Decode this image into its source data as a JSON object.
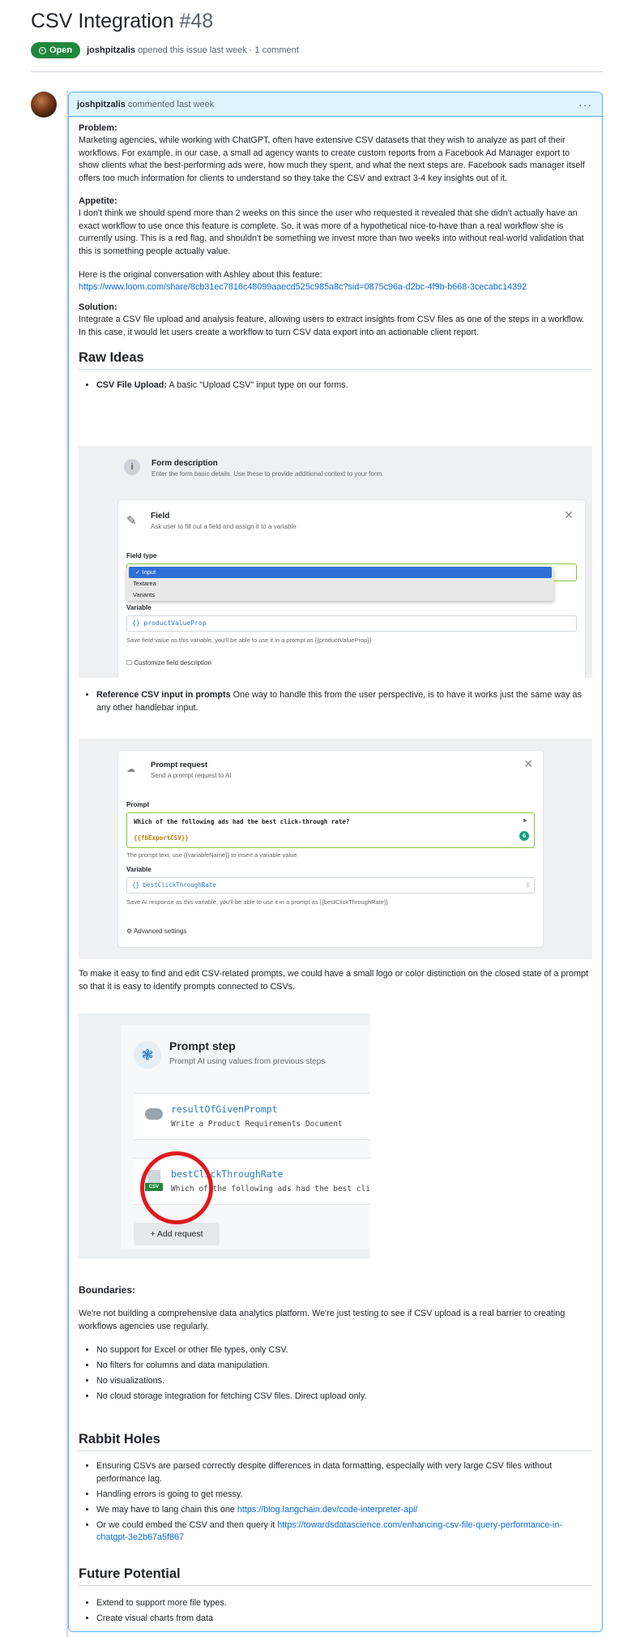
{
  "issue": {
    "title": "CSV Integration",
    "number": "#48",
    "state": "Open",
    "author": "joshpitzalis",
    "meta": "opened this issue last week · 1 comment"
  },
  "comment": {
    "author": "joshpitzalis",
    "time": "commented last week",
    "menu": "···"
  },
  "body": {
    "problem_label": "Problem:",
    "problem_text": "Marketing agencies, while working with ChatGPT, often have extensive CSV datasets that they wish to analyze as part of their workflows. For example, in our case, a small ad agency wants to create custom reports from a Facebook Ad Manager export to show clients what the best-performing ads were, how much they spent, and what the next steps are. Facebook sads manager itself offers too much information for clients to understand so they take the CSV and extract 3-4 key insights out of it.",
    "appetite_label": "Appetite:",
    "appetite_text": "I don't think we should spend more than 2 weeks on this since the user who requested it revealed that she didn't actually have an exact workflow to use once this feature is complete. So, it was more of a hypothetical nice-to-have than a real workflow she is currently using. This is a red flag, and shouldn't be something we invest more than two weeks into without real-world validation that this is something people actually value.",
    "original_convo": "Here is the original conversation with Ashley about this feature:",
    "loom_url": "https://www.loom.com/share/8cb31ec7816c48099aaecd525c985a8c?sid=0875c96a-d2bc-4f9b-b668-3cecabc14392",
    "solution_label": "Solution:",
    "solution_text": "Integrate a CSV file upload and analysis feature, allowing users to extract insights from CSV files as one of the steps in a workflow. In this case, it would let users create a workflow to turn CSV data export into an actionable client report.",
    "raw_ideas_heading": "Raw Ideas",
    "idea1_bold": "CSV File Upload:",
    "idea1_text": " A basic \"Upload CSV\" input type on our forms.",
    "idea2_bold": "Reference CSV input in prompts",
    "idea2_text": " One way to handle this from the user perspective, is to have it works just the same way as any other handlebar input.",
    "distinction_text": "To make it easy to find and edit CSV-related prompts, we could have a small logo or color distinction on the closed state of a prompt so that it is easy to identify prompts connected to CSVs.",
    "boundaries_label": "Boundaries:",
    "boundaries_text": "We're not building a comprehensive data analytics platform. We're just testing to see if CSV upload is a real barrier to creating workflows agencies use regularly.",
    "boundaries_list": [
      "No support for Excel or other file types, only CSV.",
      "No filters for columns and data manipulation.",
      "No visualizations.",
      "No cloud storage integration for fetching CSV files. Direct upload only."
    ],
    "rabbit_heading": "Rabbit Holes",
    "rabbit1": "Ensuring CSVs are parsed correctly despite differences in data formatting, especially with very large CSV files without performance lag.",
    "rabbit2": "Handling errors is going to get messy.",
    "rabbit3_text": "We may have to lang chain this one ",
    "rabbit3_link": "https://blog.langchain.dev/code-interpreter-api/",
    "rabbit4_text": "Or we could embed the CSV and then query it ",
    "rabbit4_link": "https://towardsdatascience.com/enhancing-csv-file-query-performance-in-chatgpt-3e2b67a5f867",
    "future_heading": "Future Potential",
    "future_list": [
      "Extend to support more file types.",
      "Create visual charts from data"
    ]
  },
  "shot1": {
    "icon": "i",
    "desc_title": "Form description",
    "desc_sub": "Enter the form basic details. Use these to provide additional context to your form.",
    "field_title": "Field",
    "field_sub": "Ask user to fill out a field and assign it to a variable",
    "close": "✕",
    "field_type_label": "Field type",
    "options": [
      "✓ Input",
      "Textarea",
      "Variants"
    ],
    "variable_label": "Variable",
    "variable_value": "{} productValueProp",
    "variable_help": "Save field value as this variable, you'll be able to use it in a prompt as {{productValueProp}}",
    "customize": "Customize field description"
  },
  "shot2": {
    "title": "Prompt request",
    "sub": "Send a prompt request to AI",
    "close": "✕",
    "prompt_label": "Prompt",
    "prompt_line1": "Which of the following ads had the best click-through rate?",
    "prompt_line2": "{{fbExportCSV}}",
    "prompt_hint": "The prompt text, use {{variableName}} to insert a variable value",
    "variable_label": "Variable",
    "variable_value": "{} bestClickThroughRate",
    "variable_help": "Save AI response as this variable, you'll be able to use it in a prompt as {{bestClickThroughRate}}",
    "advanced": "Advanced settings"
  },
  "shot3": {
    "title": "Prompt step",
    "sub": "Prompt AI using values from previous steps",
    "req1_name": "resultOfGivenPrompt",
    "req1_desc": "Write a Product Requirements Document",
    "req2_name": "bestClickThroughRate",
    "req2_desc": "Which of the following ads had the best click-through rate?",
    "csv_tag": "CSV",
    "add_request": "+ Add request"
  },
  "reaction_icon": "☺",
  "colors": {
    "open": "#1f883d",
    "link": "#0969da",
    "header_bg": "#ddf4ff",
    "highlight": "#e0191d"
  }
}
